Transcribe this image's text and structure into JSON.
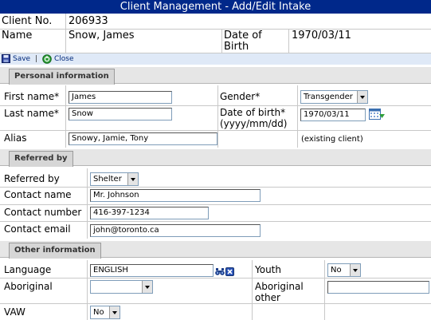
{
  "window": {
    "title": "Client Management - Add/Edit Intake"
  },
  "header": {
    "client_no_label": "Client No.",
    "client_no": "206933",
    "name_label": "Name",
    "name": "Snow, James",
    "dob_label_1": "Date of",
    "dob_label_2": "Birth",
    "dob": "1970/03/11"
  },
  "toolbar": {
    "save_label": "Save",
    "separator": "|",
    "close_label": "Close"
  },
  "personal": {
    "section_title": "Personal information",
    "first_name_label": "First name*",
    "first_name": "James",
    "last_name_label": "Last name*",
    "last_name": "Snow",
    "alias_label": "Alias",
    "alias": "Snowy, Jamie, Tony",
    "gender_label": "Gender*",
    "gender": "Transgender",
    "dob_label_1": "Date of birth*",
    "dob_label_2": "(yyyy/mm/dd)",
    "dob": "1970/03/11",
    "existing_note": "(existing client)"
  },
  "referral": {
    "section_title": "Referred by",
    "referred_by_label": "Referred by",
    "referred_by": "Shelter",
    "contact_name_label": "Contact name",
    "contact_name": "Mr. Johnson",
    "contact_number_label": "Contact number",
    "contact_number": "416-397-1234",
    "contact_email_label": "Contact email",
    "contact_email": "john@toronto.ca"
  },
  "other": {
    "section_title": "Other information",
    "language_label": "Language",
    "language": "ENGLISH",
    "youth_label": "Youth",
    "youth": "No",
    "aboriginal_label": "Aboriginal",
    "aboriginal": "",
    "aboriginal_other_label_1": "Aboriginal",
    "aboriginal_other_label_2": "other",
    "aboriginal_other": "",
    "vaw_label": "VAW",
    "vaw": "No"
  },
  "icons": {
    "save": "floppy-disk-icon",
    "close": "green-circle-close-icon",
    "calendar": "calendar-icon",
    "search": "binoculars-icon",
    "clear": "blue-x-icon"
  },
  "colors": {
    "title_bar": "#00288a",
    "toolbar_bg": "#dfe9f7",
    "section_tab_bg": "#d6d6d6",
    "input_border": "#7f9db9"
  }
}
